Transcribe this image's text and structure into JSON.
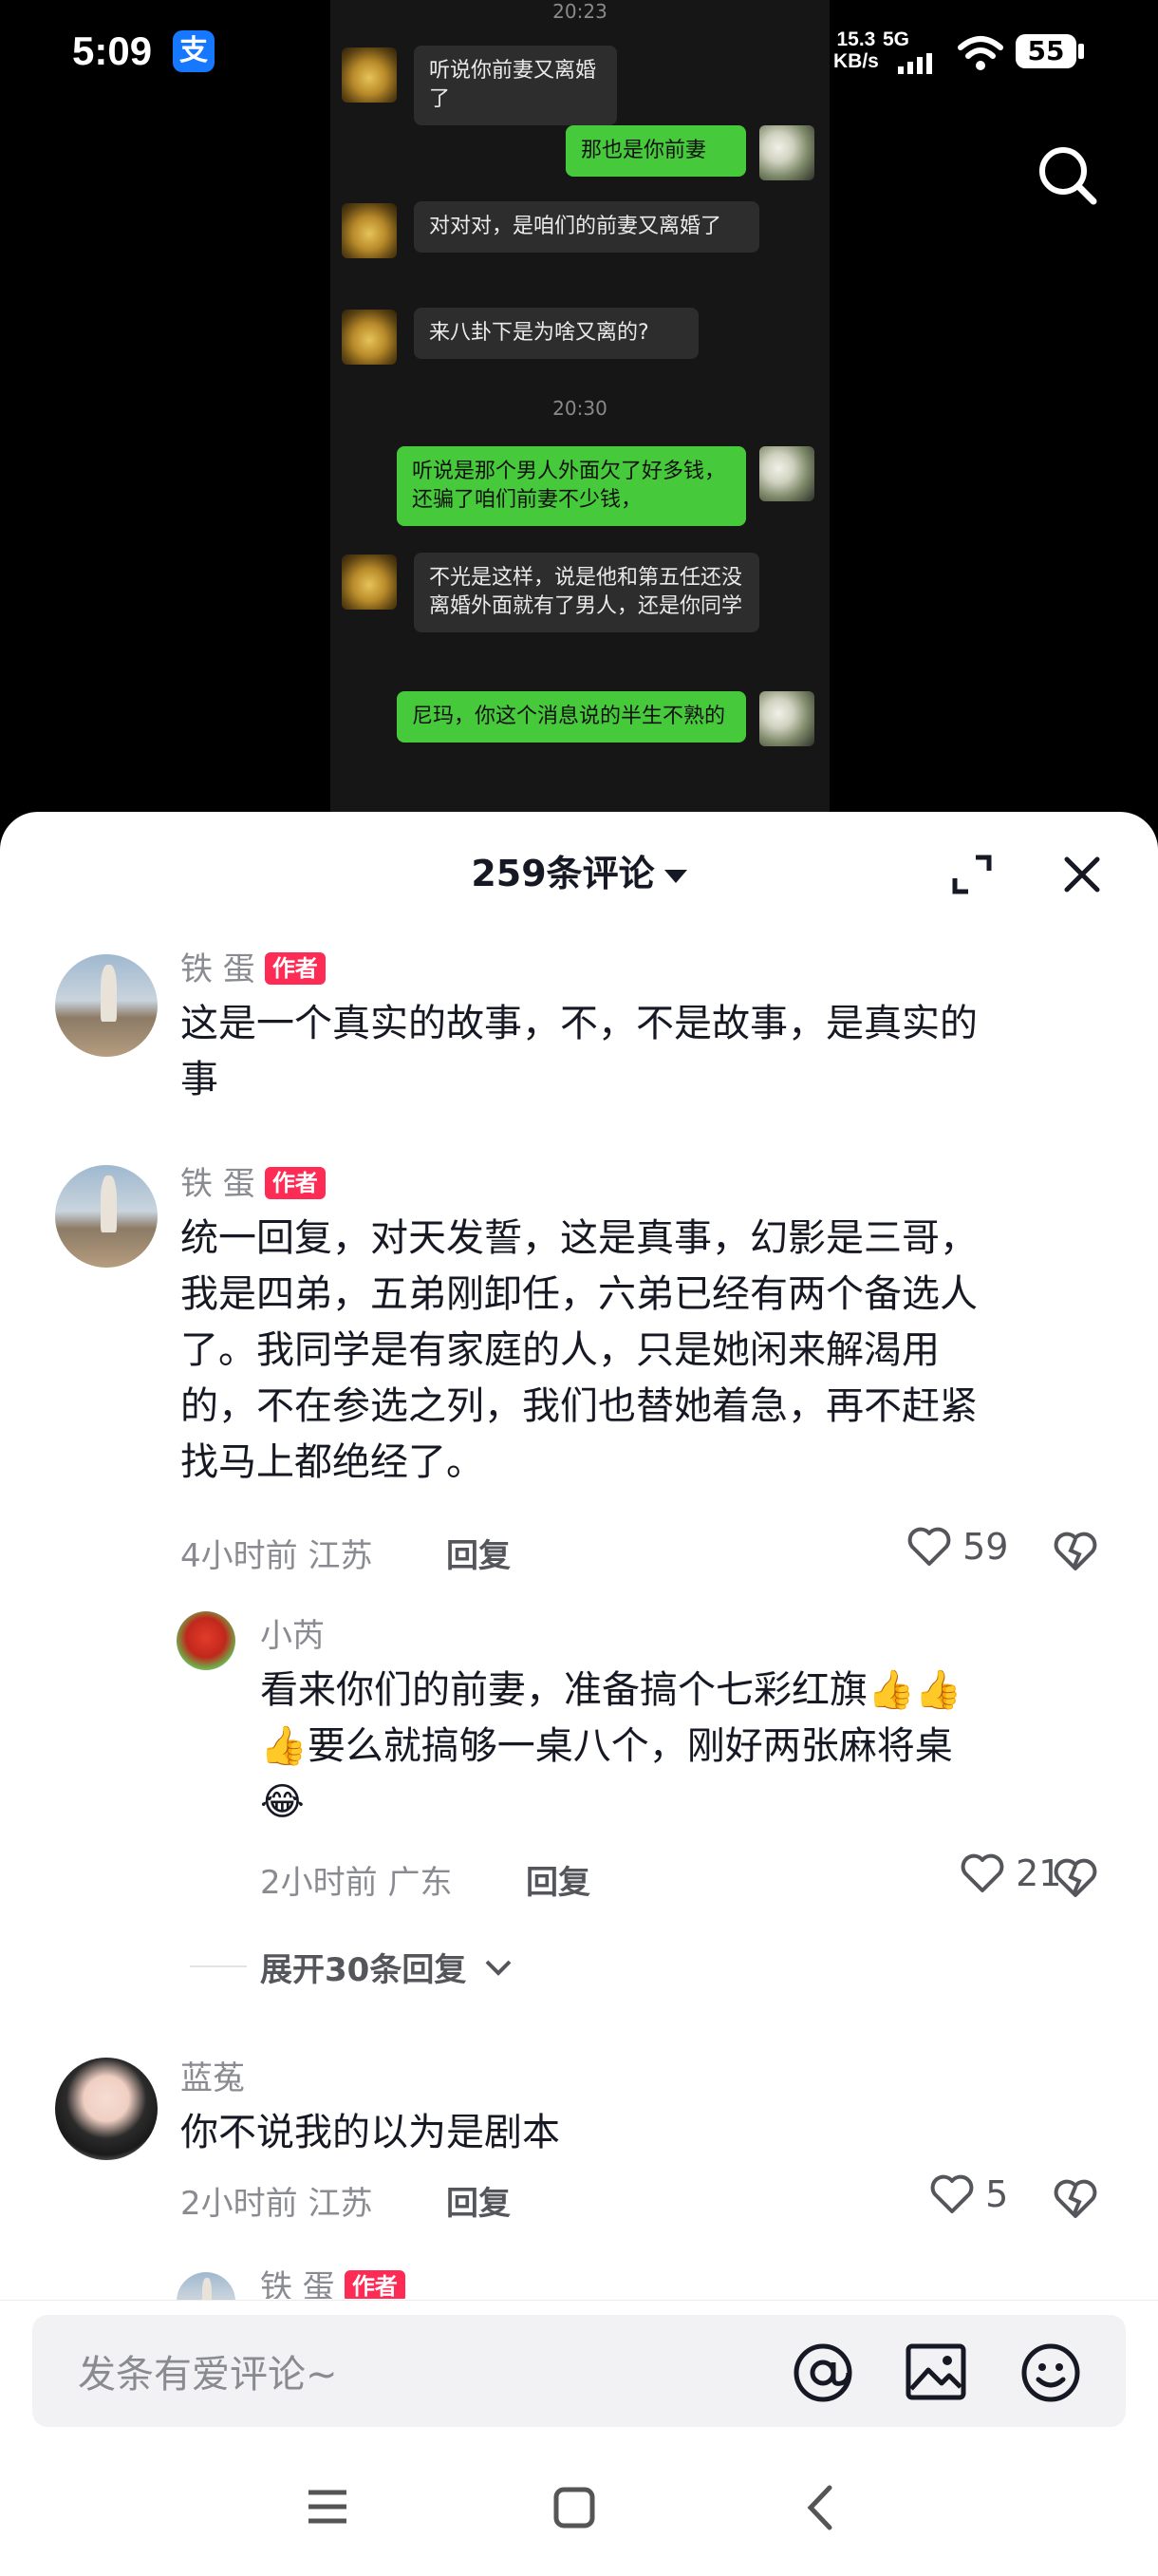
{
  "status_bar": {
    "time": "5:09",
    "app_icon": "支",
    "net_speed_value": "15.3",
    "net_speed_unit": "KB/s",
    "network": "5G",
    "battery": "55"
  },
  "chat_screenshot": {
    "timestamps": [
      "20:23",
      "20:30"
    ],
    "messages": [
      {
        "side": "left",
        "text": "听说你前妻又离婚了"
      },
      {
        "side": "right",
        "text": "那也是你前妻"
      },
      {
        "side": "left",
        "text": "对对对，是咱们的前妻又离婚了"
      },
      {
        "side": "left",
        "text": "来八卦下是为啥又离的?"
      },
      {
        "side": "right",
        "text": "听说是那个男人外面欠了好多钱，还骗了咱们前妻不少钱，"
      },
      {
        "side": "left",
        "text": "不光是这样，说是他和第五任还没离婚外面就有了男人，还是你同学"
      },
      {
        "side": "right",
        "text": "尼玛，你这个消息说的半生不熟的"
      }
    ]
  },
  "comments_panel": {
    "title": "259条评论",
    "author_tag": "作者",
    "comments": [
      {
        "user": "铁  蛋",
        "is_author": true,
        "text_lines": [
          "这是一个真实的故事，不，不是故事，是真实的",
          "事"
        ]
      },
      {
        "user": "铁  蛋",
        "is_author": true,
        "text_lines": [
          "统一回复，对天发誓，这是真事，幻影是三哥，",
          "我是四弟，五弟刚卸任，六弟已经有两个备选人",
          "了。我同学是有家庭的人，只是她闲来解渴用",
          "的，不在参选之列，我们也替她着急，再不赶紧",
          "找马上都绝经了。"
        ],
        "meta": "4小时前 江苏",
        "reply_label": "回复",
        "likes": "59",
        "reply": {
          "user": "小芮",
          "text_line1": "看来你们的前妻，准备搞个七彩红旗",
          "text_line2": "要么就搞够一桌八个，刚好两张麻将桌",
          "meta": "2小时前 广东",
          "reply_label": "回复",
          "likes": "21"
        },
        "expand_label": "展开30条回复"
      },
      {
        "user": "蓝菟",
        "is_author": false,
        "text_lines": [
          "你不说我的以为是剧本"
        ],
        "meta": "2小时前 江苏",
        "reply_label": "回复",
        "likes": "5"
      },
      {
        "user": "铁  蛋",
        "is_author": true
      }
    ]
  },
  "input": {
    "placeholder": "发条有爱评论~"
  }
}
